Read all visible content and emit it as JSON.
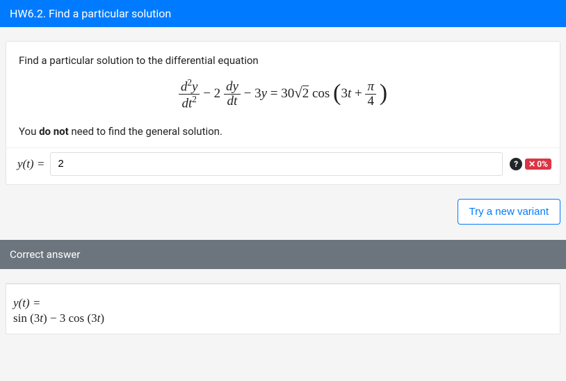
{
  "title": "HW6.2. Find a particular solution",
  "question": {
    "prompt": "Find a particular solution to the differential equation",
    "note_pre": "You ",
    "note_bold": "do not",
    "note_post": " need to find the general solution.",
    "input_label": "y(t) =",
    "input_value": "2",
    "equation": {
      "term1": {
        "num_var": "d",
        "num_exp": "2",
        "num_y": "y",
        "den_var": "dt",
        "den_exp": "2"
      },
      "minus1": " − 2",
      "term2": {
        "num": "dy",
        "den": "dt"
      },
      "minus2": " − 3",
      "yvar": "y",
      "eq": " = 30",
      "sqrt_content": "2",
      "cos": " cos ",
      "inside_a": "3",
      "inside_t": "t",
      "inside_plus": " + ",
      "pi": "π",
      "four": "4"
    }
  },
  "feedback": {
    "score_text": "0%"
  },
  "actions": {
    "try_new": "Try a new variant"
  },
  "answer_header": "Correct answer",
  "answer": {
    "label": "y(t) =",
    "value_parts": {
      "sin": "sin ",
      "open": "(3",
      "t": "t",
      "close": ")",
      "minus": " − 3 ",
      "cos": "cos "
    }
  }
}
